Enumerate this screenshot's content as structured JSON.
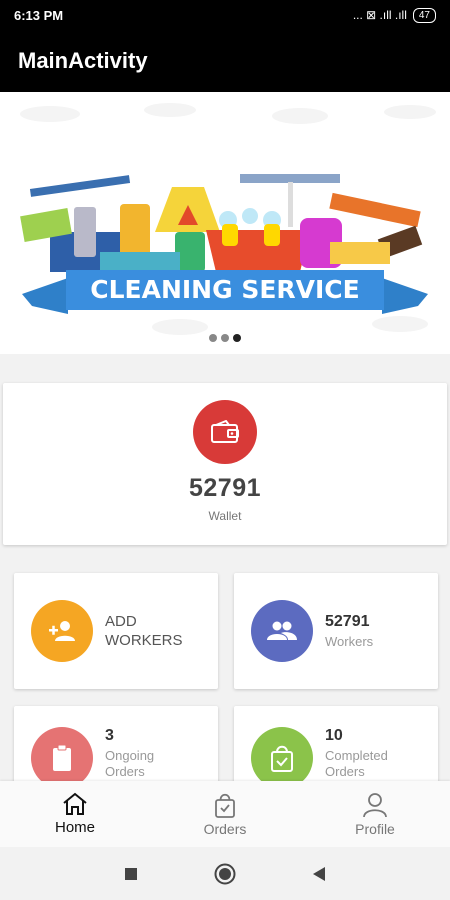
{
  "status_bar": {
    "time": "6:13 PM",
    "icons": "... ⊠ .ıll .ıll",
    "battery": "47"
  },
  "app_bar": {
    "title": "MainActivity"
  },
  "banner": {
    "text": "CLEANING SERVICE"
  },
  "wallet": {
    "value": "52791",
    "label": "Wallet"
  },
  "cards": {
    "add_workers": {
      "label": "ADD WORKERS"
    },
    "workers": {
      "value": "52791",
      "label": "Workers"
    },
    "ongoing": {
      "value": "3",
      "label": "Ongoing Orders"
    },
    "completed": {
      "value": "10",
      "label": "Completed Orders"
    }
  },
  "bottom_nav": {
    "home": "Home",
    "orders": "Orders",
    "profile": "Profile"
  },
  "colors": {
    "wallet": "#d83a38",
    "add_workers": "#f5a623",
    "workers": "#5c6bc0",
    "ongoing": "#e57373",
    "completed": "#8bc34a"
  }
}
